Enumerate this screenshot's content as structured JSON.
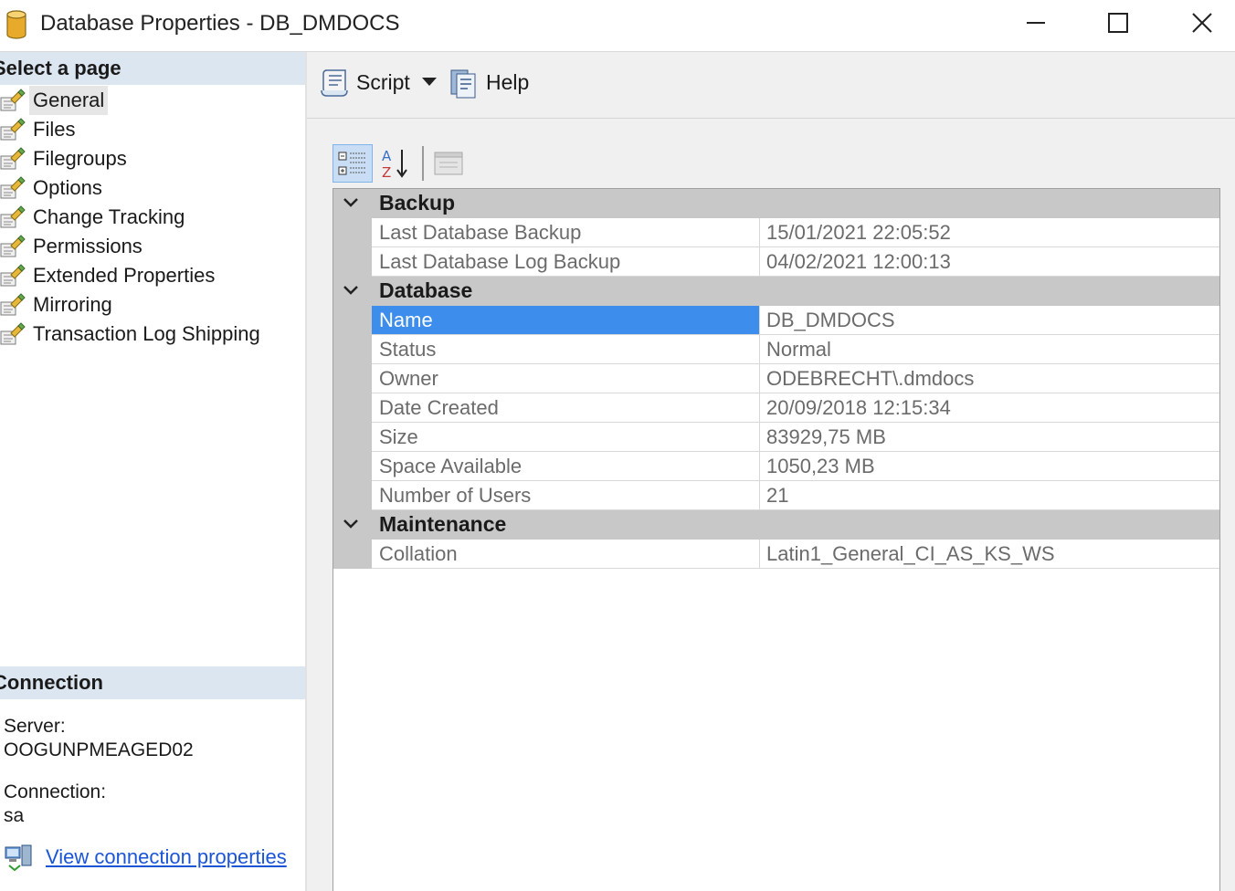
{
  "window": {
    "title": "Database Properties - DB_DMDOCS"
  },
  "left_pane": {
    "select_page_header": "Select a page",
    "pages": [
      {
        "label": "General",
        "selected": true
      },
      {
        "label": "Files"
      },
      {
        "label": "Filegroups"
      },
      {
        "label": "Options"
      },
      {
        "label": "Change Tracking"
      },
      {
        "label": "Permissions"
      },
      {
        "label": "Extended Properties"
      },
      {
        "label": "Mirroring"
      },
      {
        "label": "Transaction Log Shipping"
      }
    ],
    "connection_header": "Connection",
    "server_label": "Server:",
    "server_value": "OOGUNPMEAGED02",
    "connection_label": "Connection:",
    "connection_value": "sa",
    "view_connection_link": "View connection properties"
  },
  "toolbar": {
    "script_label": "Script",
    "help_label": "Help"
  },
  "property_grid": {
    "selected_row": "Name",
    "categories": [
      {
        "label": "Backup",
        "rows": [
          {
            "name": "Last Database Backup",
            "value": "15/01/2021 22:05:52"
          },
          {
            "name": "Last Database Log Backup",
            "value": "04/02/2021 12:00:13"
          }
        ]
      },
      {
        "label": "Database",
        "rows": [
          {
            "name": "Name",
            "value": "DB_DMDOCS"
          },
          {
            "name": "Status",
            "value": "Normal"
          },
          {
            "name": "Owner",
            "value": "ODEBRECHT\\.dmdocs"
          },
          {
            "name": "Date Created",
            "value": "20/09/2018 12:15:34"
          },
          {
            "name": "Size",
            "value": "83929,75 MB"
          },
          {
            "name": "Space Available",
            "value": "1050,23 MB"
          },
          {
            "name": "Number of Users",
            "value": "21"
          }
        ]
      },
      {
        "label": "Maintenance",
        "rows": [
          {
            "name": "Collation",
            "value": "Latin1_General_CI_AS_KS_WS"
          }
        ]
      }
    ]
  },
  "colors": {
    "selection": "#3d8eec",
    "section_header": "#dce6f0",
    "link": "#1a55d6",
    "category_band": "#c8c8c8"
  }
}
